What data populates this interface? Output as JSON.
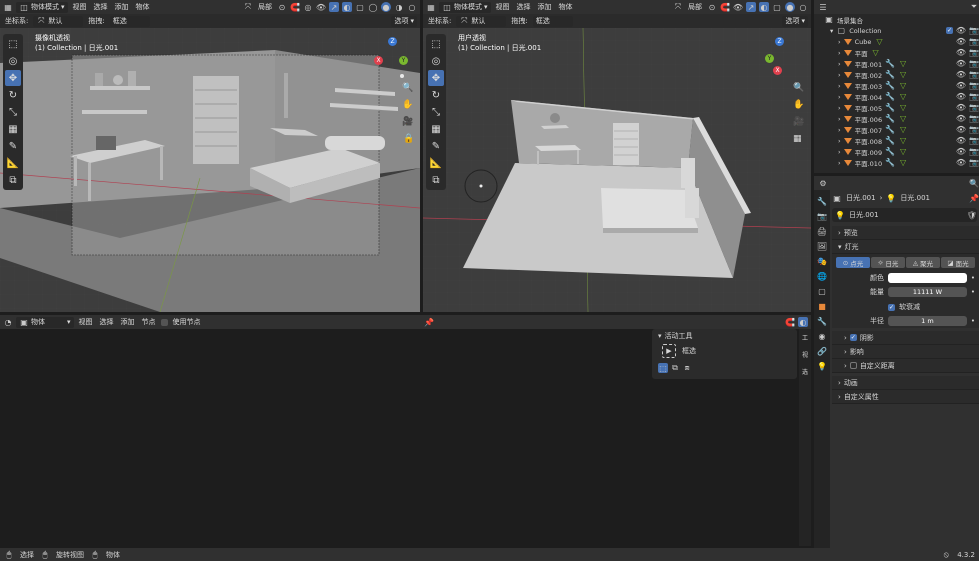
{
  "left_view": {
    "mode": "物体模式",
    "menus": [
      "视图",
      "选择",
      "添加",
      "物体"
    ],
    "global": "局部",
    "coord_label": "坐标系:",
    "coord_value": "默认",
    "drag_label": "拖拽:",
    "drag_value": "框选",
    "options": "选项",
    "title": "摄像机透视",
    "subtitle": "(1) Collection | 日光.001"
  },
  "right_view": {
    "mode": "物体模式",
    "menus": [
      "视图",
      "选择",
      "添加",
      "物体"
    ],
    "global": "局部",
    "coord_label": "坐标系:",
    "coord_value": "默认",
    "drag_label": "拖拽:",
    "drag_value": "框选",
    "options": "选项",
    "title": "用户透视",
    "subtitle": "(1) Collection | 日光.001"
  },
  "gizmo": {
    "x": "X",
    "y": "Y",
    "z": "Z"
  },
  "outliner": {
    "root": "场景集合",
    "collection": "Collection",
    "items": [
      "Cube",
      "平面",
      "平面.001",
      "平面.002",
      "平面.003",
      "平面.004",
      "平面.005",
      "平面.006",
      "平面.007",
      "平面.008",
      "平面.009",
      "平面.010"
    ]
  },
  "node_editor": {
    "mode": "物体",
    "menus": [
      "视图",
      "选择",
      "添加",
      "节点"
    ],
    "use_nodes": "使用节点",
    "panel_title": "活动工具",
    "tool_name": "框选"
  },
  "properties": {
    "breadcrumb_obj": "日光.001",
    "breadcrumb_data": "日光.001",
    "datablock": "日光.001",
    "preview": "预览",
    "light_section": "灯光",
    "light_types": [
      "点光",
      "日光",
      "聚光",
      "面光"
    ],
    "active_type": "点光",
    "color_label": "颜色",
    "power_label": "能量",
    "power_value": "11111 W",
    "soft_falloff": "软衰减",
    "radius_label": "半径",
    "radius_value": "1 m",
    "shadow": "阴影",
    "influence": "影响",
    "custom_distance": "自定义距离",
    "animation": "动画",
    "custom_props": "自定义属性"
  },
  "statusbar": {
    "select": "选择",
    "rotate": "旋转视图",
    "object": "物体",
    "version": "4.3.2"
  },
  "colors": {
    "accent": "#4772b3",
    "x_axis": "#e0404d",
    "y_axis": "#7ab82f",
    "z_axis": "#3a78d4"
  }
}
